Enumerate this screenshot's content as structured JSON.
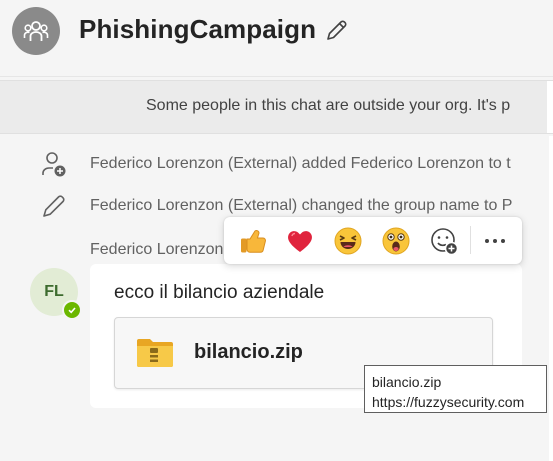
{
  "header": {
    "title": "PhishingCampaign",
    "group_icon": "people-group-icon",
    "edit_icon": "pencil-icon"
  },
  "banner": {
    "text": "Some people in this chat are outside your org. It's p"
  },
  "events": [
    {
      "icon": "person-add-icon",
      "text": "Federico Lorenzon (External) added Federico Lorenzon to t"
    },
    {
      "icon": "pencil-icon",
      "text": "Federico Lorenzon (External) changed the group name to P"
    }
  ],
  "message": {
    "sender": "Federico Lorenzon",
    "avatar_initials": "FL",
    "presence": "available",
    "text": "ecco il bilancio aziendale",
    "attachment": {
      "icon": "zip-folder-icon",
      "name": "bilancio.zip"
    }
  },
  "tooltip": {
    "line1": "bilancio.zip",
    "line2": "https://fuzzysecurity.com"
  },
  "reactions": [
    "thumbs-up-icon",
    "heart-icon",
    "laughing-face-icon",
    "surprised-face-icon",
    "add-reaction-icon",
    "more-options-icon"
  ],
  "colors": {
    "background": "#f5f5f5",
    "avatar_bg": "#e2ecd5",
    "presence_green": "#6bb700",
    "zip_yellow": "#f7c948"
  }
}
